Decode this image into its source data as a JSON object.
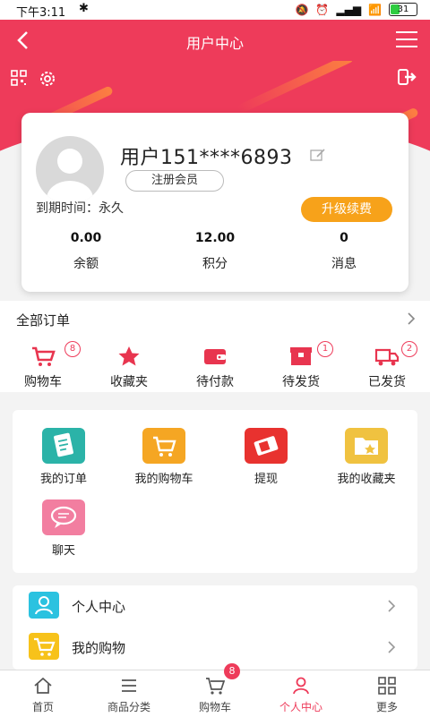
{
  "status_bar": {
    "time": "下午3:11",
    "battery": "31"
  },
  "header": {
    "title": "用户中心"
  },
  "profile": {
    "username": "用户151****6893",
    "member_level": "注册会员",
    "expiry": "到期时间：永久",
    "upgrade_label": "升级续费",
    "stats": [
      {
        "value": "0.00",
        "label": "余额"
      },
      {
        "value": "12.00",
        "label": "积分"
      },
      {
        "value": "0",
        "label": "消息"
      }
    ]
  },
  "orders": {
    "all_label": "全部订单",
    "items": [
      {
        "label": "购物车",
        "badge": "8",
        "icon": "cart-icon"
      },
      {
        "label": "收藏夹",
        "badge": "",
        "icon": "star-icon"
      },
      {
        "label": "待付款",
        "badge": "",
        "icon": "wallet-icon"
      },
      {
        "label": "待发货",
        "badge": "1",
        "icon": "package-icon"
      },
      {
        "label": "已发货",
        "badge": "2",
        "icon": "truck-icon"
      }
    ]
  },
  "grid": [
    {
      "label": "我的订单",
      "color": "#2bb3a8",
      "icon": "order-list-icon"
    },
    {
      "label": "我的购物车",
      "color": "#f5a623",
      "icon": "cart-icon"
    },
    {
      "label": "提现",
      "color": "#e8322f",
      "icon": "withdraw-icon"
    },
    {
      "label": "我的收藏夹",
      "color": "#f0c240",
      "icon": "folder-star-icon"
    },
    {
      "label": "聊天",
      "color": "#f27ea0",
      "icon": "chat-icon"
    }
  ],
  "list": [
    {
      "label": "个人中心",
      "color": "#2bc2e0",
      "icon": "person-icon"
    },
    {
      "label": "我的购物",
      "color": "#f7c21a",
      "icon": "cart-icon"
    }
  ],
  "tabbar": [
    {
      "label": "首页",
      "icon": "home-icon"
    },
    {
      "label": "商品分类",
      "icon": "list-icon"
    },
    {
      "label": "购物车",
      "icon": "cart-icon",
      "badge": "8"
    },
    {
      "label": "个人中心",
      "icon": "person-icon",
      "active": true
    },
    {
      "label": "更多",
      "icon": "grid-icon"
    }
  ],
  "colors": {
    "brand": "#ee3b5a",
    "accent": "#f7a21a"
  }
}
